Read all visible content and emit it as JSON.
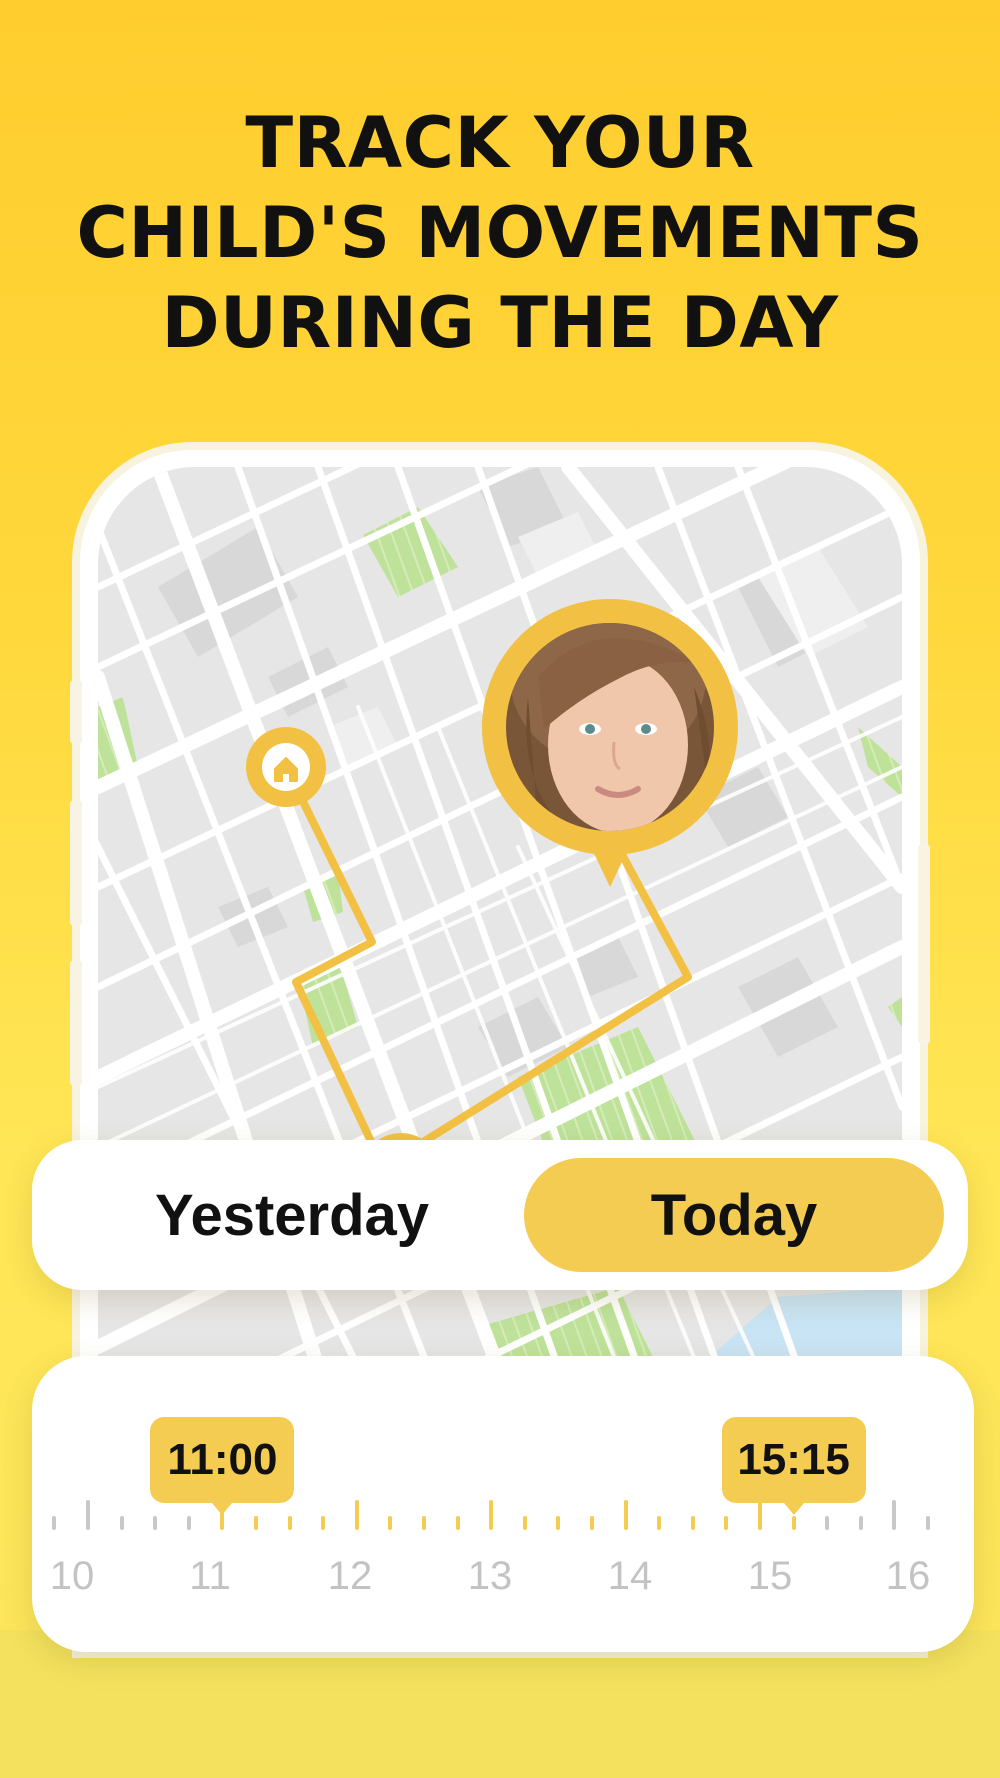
{
  "headline": {
    "line1": "TRACK YOUR",
    "line2": "CHILD'S MOVEMENTS",
    "line3": "DURING THE DAY"
  },
  "map": {
    "child_avatar_icon": "child-photo-pin",
    "home_icon": "home-pin-icon"
  },
  "day_toggle": {
    "yesterday_label": "Yesterday",
    "today_label": "Today",
    "selected": "Today"
  },
  "timeline": {
    "start_time": "11:00",
    "end_time": "15:15",
    "hour_labels": [
      "10",
      "11",
      "12",
      "13",
      "14",
      "15",
      "16"
    ]
  },
  "colors": {
    "accent": "#f5cc52",
    "background": "#ffd83c",
    "park": "#bfe29b",
    "water": "#c9e4f5"
  }
}
